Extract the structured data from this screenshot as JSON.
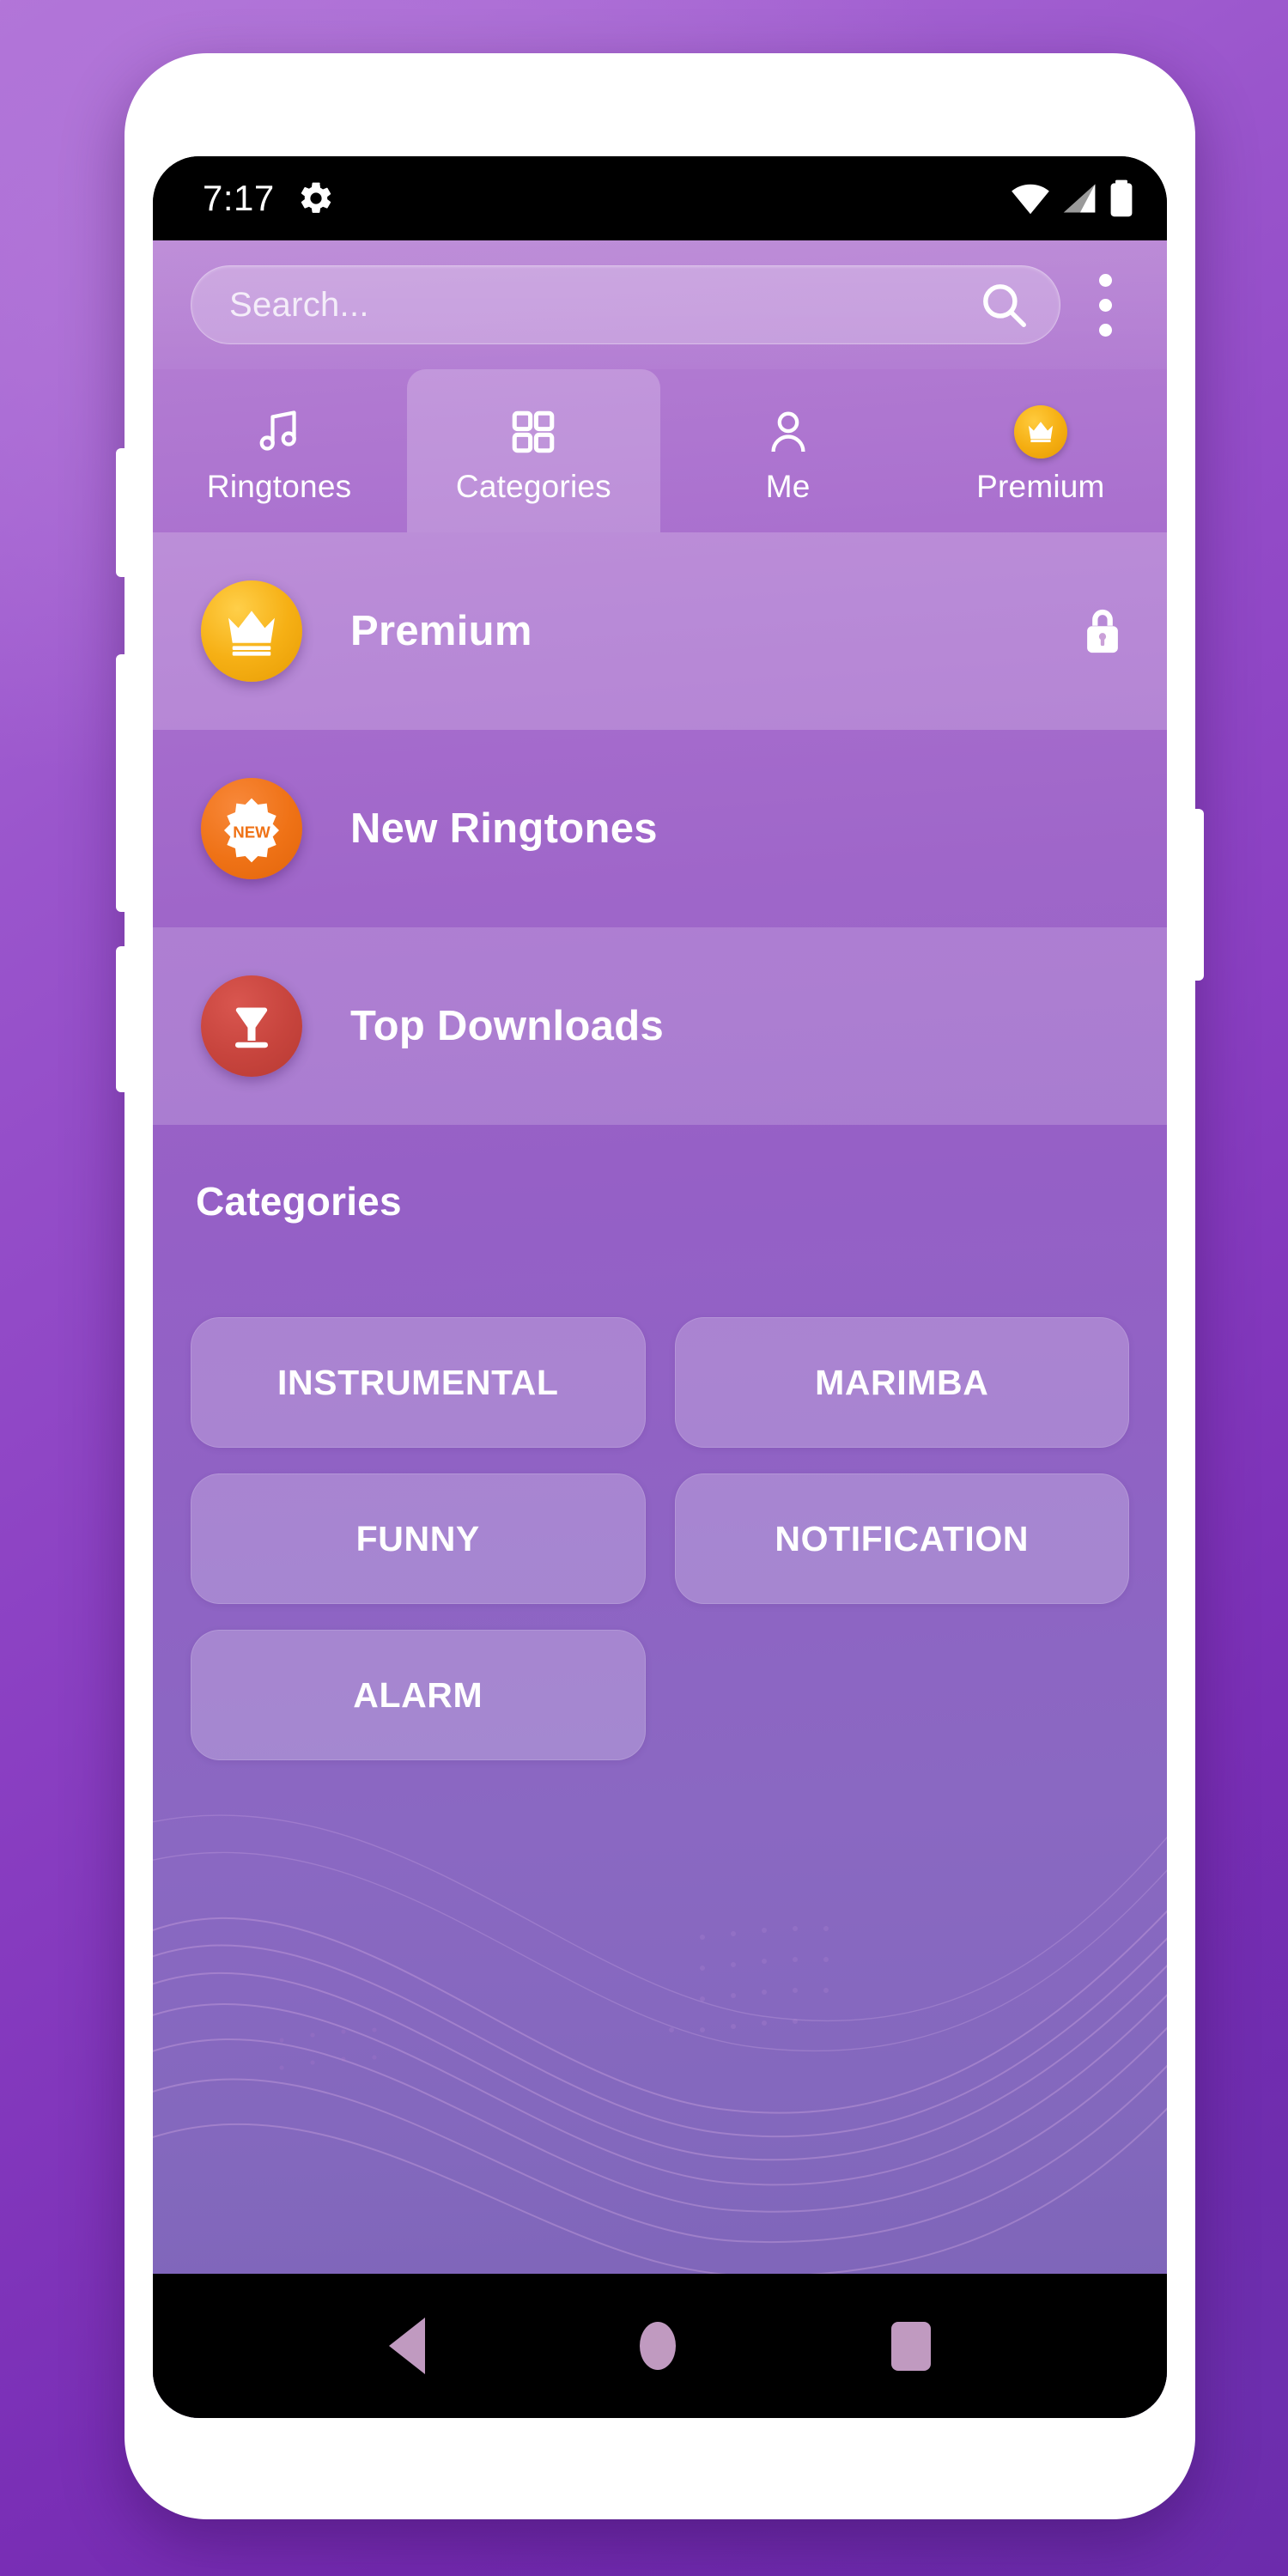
{
  "device": {
    "status_bar": {
      "time": "7:17",
      "left_icons": [
        "gear-icon"
      ],
      "right_icons": [
        "wifi-icon",
        "cellular-signal-icon",
        "battery-icon"
      ]
    },
    "nav_bar": {
      "back_label": "Back",
      "home_label": "Home",
      "recents_label": "Recents",
      "icon_color": "#c09ac0"
    }
  },
  "app": {
    "search": {
      "placeholder": "Search...",
      "value": "",
      "icon": "search-icon"
    },
    "overflow": {
      "label": "More options",
      "icon": "three-dot-vertical-icon"
    },
    "tabs": [
      {
        "label": "Ringtones",
        "icon": "music-note-icon",
        "selected": false
      },
      {
        "label": "Categories",
        "icon": "grid-icon",
        "selected": true
      },
      {
        "label": "Me",
        "icon": "person-icon",
        "selected": false
      },
      {
        "label": "Premium",
        "icon": "crown-badge-icon",
        "selected": false
      }
    ],
    "feature_rows": [
      {
        "label": "Premium",
        "icon": "crown-icon",
        "icon_color": "#f6b015",
        "trailing_icon": "lock-icon"
      },
      {
        "label": "New Ringtones",
        "icon": "new-badge-icon",
        "icon_color": "#ef7216",
        "trailing_icon": ""
      },
      {
        "label": "Top Downloads",
        "icon": "download-icon",
        "icon_color": "#c7443d",
        "trailing_icon": ""
      }
    ],
    "categories": {
      "title": "Categories",
      "chips": [
        "INSTRUMENTAL",
        "MARIMBA",
        "FUNNY",
        "NOTIFICATION",
        "ALARM"
      ]
    },
    "colors": {
      "accent_gold": "#f6b015",
      "accent_orange": "#ef7216",
      "accent_red": "#c7443d",
      "background_purple": "#9560c6",
      "backdrop_purple": "#8b3fc4"
    }
  }
}
